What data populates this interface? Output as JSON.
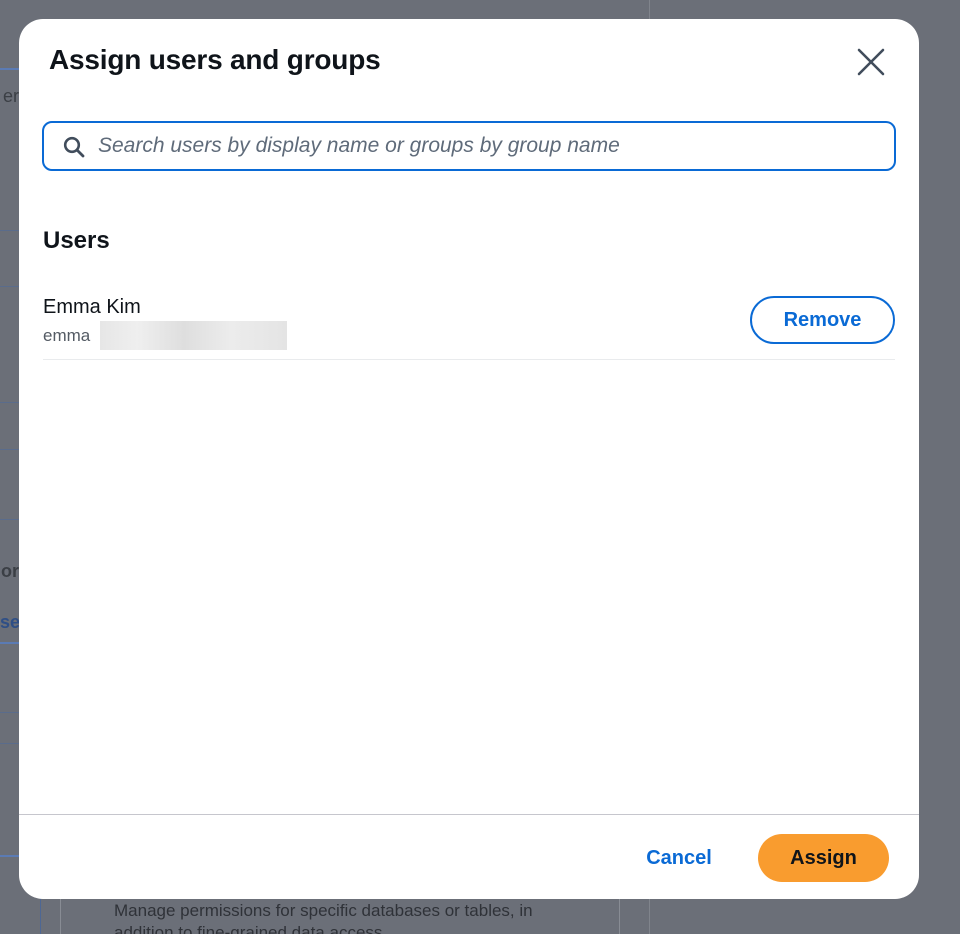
{
  "background": {
    "fragments": [
      "er",
      "or",
      "se"
    ],
    "card_text": "Manage permissions for specific databases or tables, in addition to fine-grained data access."
  },
  "modal": {
    "title": "Assign users and groups",
    "close_icon": "close-icon",
    "search": {
      "placeholder": "Search users by display name or groups by group name",
      "value": "",
      "icon": "search-icon"
    },
    "users_section": {
      "heading": "Users",
      "items": [
        {
          "name": "Emma Kim",
          "email_visible": "emma",
          "remove_label": "Remove"
        }
      ]
    },
    "footer": {
      "cancel_label": "Cancel",
      "assign_label": "Assign"
    }
  },
  "colors": {
    "accent": "#0a6ad5",
    "primary_button": "#f99c2f",
    "overlay": "#6b6f78"
  }
}
